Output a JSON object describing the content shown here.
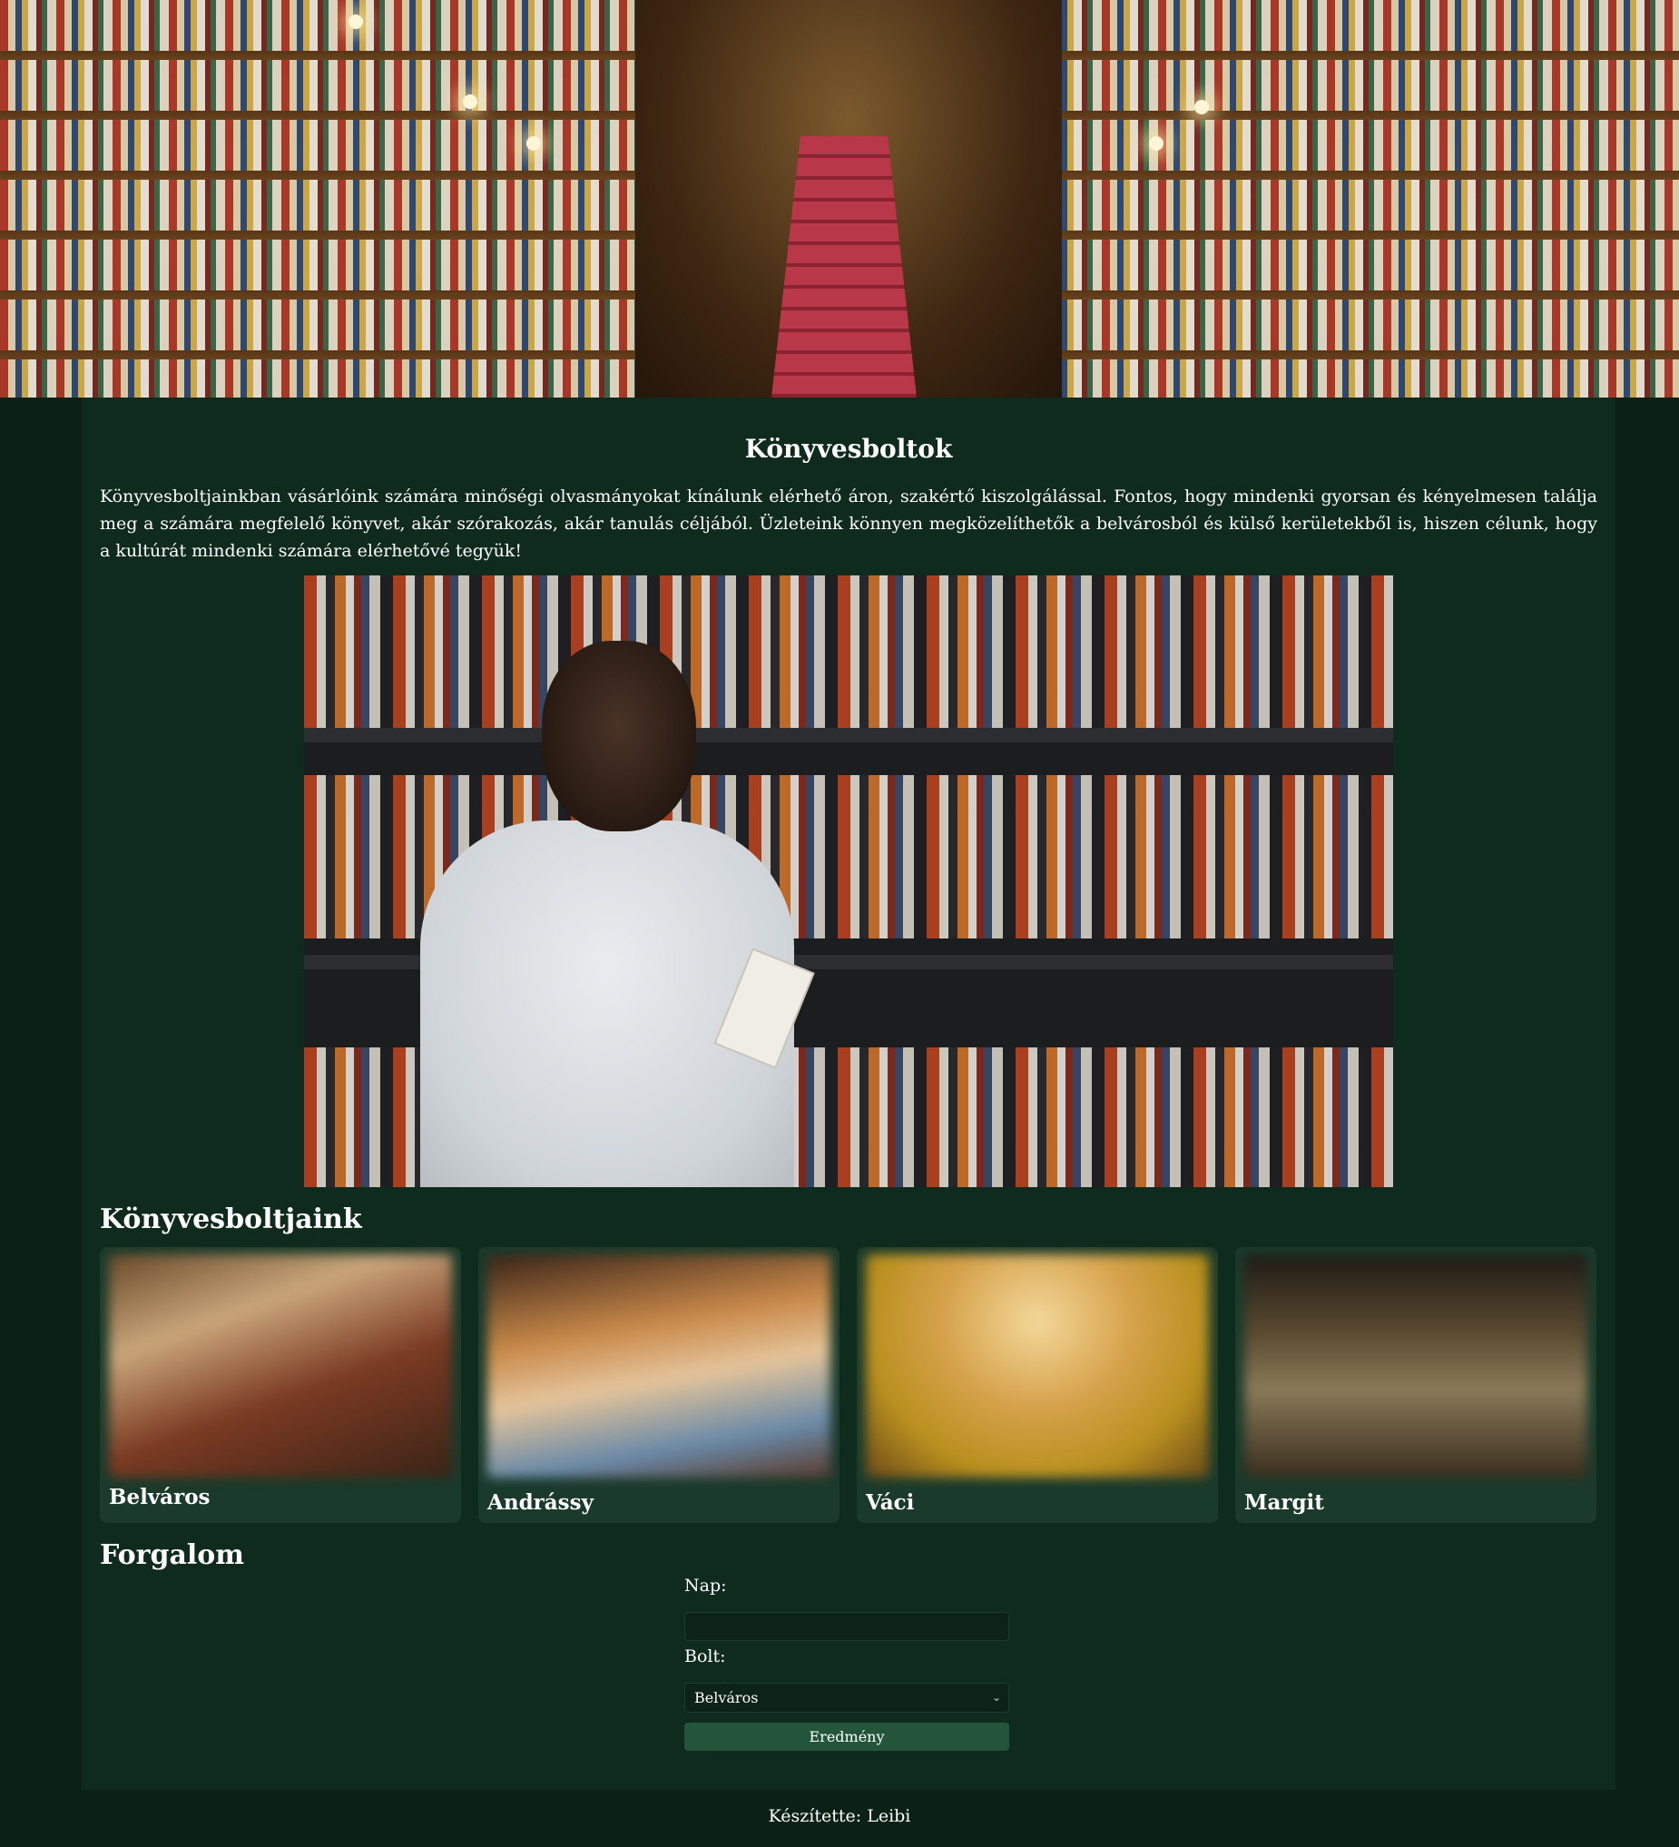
{
  "header": {
    "hero_image": "bookstore-interior-photo"
  },
  "main": {
    "title": "Könyvesboltok",
    "intro": "Könyvesboltjainkban vásárlóink számára minőségi olvasmányokat kínálunk elérhető áron, szakértő kiszolgálással. Fontos, hogy mindenki gyorsan és kényelmesen találja meg a számára megfelelő könyvet, akár szórakozás, akár tanulás céljából. Üzleteink könnyen megközelíthetők a belvárosból és külső kerületekből is, hiszen célunk, hogy a kultúrát mindenki számára elérhetővé tegyük!",
    "feature_image": "person-reading-at-bookshelf-photo"
  },
  "stores": {
    "heading": "Könyvesboltjaink",
    "items": [
      {
        "label": "Belváros"
      },
      {
        "label": "Andrássy"
      },
      {
        "label": "Váci"
      },
      {
        "label": "Margit"
      }
    ]
  },
  "traffic": {
    "heading": "Forgalom",
    "day_label": "Nap:",
    "day_value": "",
    "store_label": "Bolt:",
    "store_selected": "Belváros",
    "submit_label": "Eredmény"
  },
  "footer": {
    "credit": "Készítette: Leibi"
  },
  "colors": {
    "page_background": "#0b2116",
    "panel_background": "#0f2b1e",
    "card_background": "#1a3a2b",
    "button_background": "#22553a",
    "text": "#ffffff"
  }
}
